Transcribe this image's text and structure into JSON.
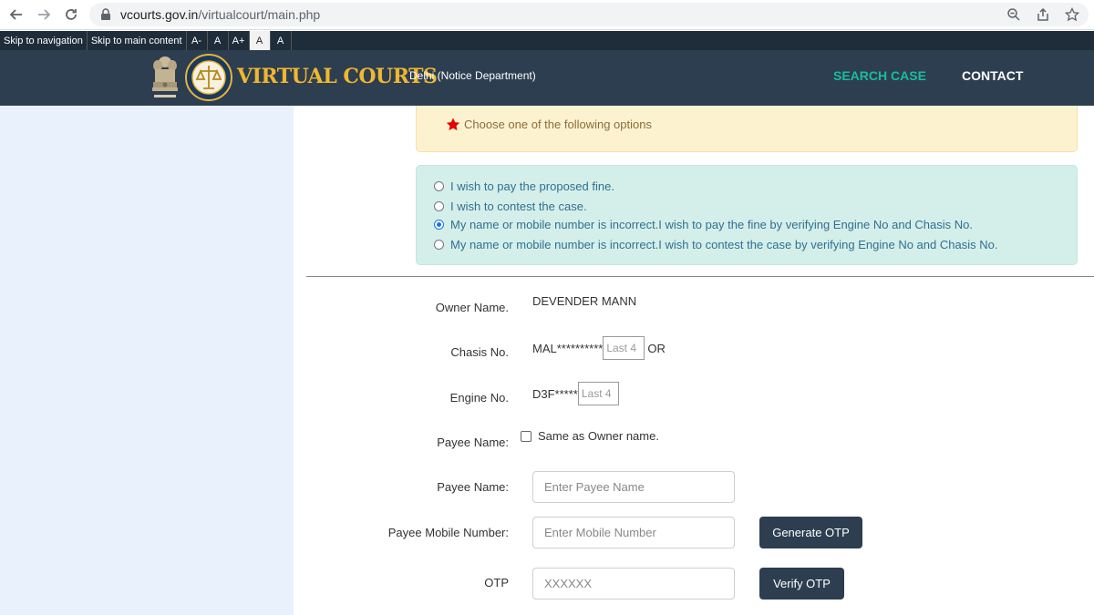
{
  "browser": {
    "url_host": "vcourts.gov.in",
    "url_path": "/virtualcourt/main.php"
  },
  "accessibility": {
    "skip_nav": "Skip to navigation",
    "skip_main": "Skip to main content",
    "font_decrease": "A-",
    "font_normal": "A",
    "font_increase": "A+",
    "theme_light": "A",
    "theme_dark": "A"
  },
  "header": {
    "brand": "VIRTUAL COURTS",
    "department": "Delhi (Notice Department)",
    "nav_search": "SEARCH CASE",
    "nav_contact": "CONTACT"
  },
  "notice": {
    "text": "Choose one of the following options"
  },
  "options": [
    {
      "label": "I wish to pay the proposed fine.",
      "selected": false
    },
    {
      "label": "I wish to contest the case.",
      "selected": false
    },
    {
      "label": "My name or mobile number is incorrect.I wish to pay the fine by verifying Engine No and Chasis No.",
      "selected": true
    },
    {
      "label": "My name or mobile number is incorrect.I wish to contest the case by verifying Engine No and Chasis No.",
      "selected": false
    }
  ],
  "form": {
    "owner_label": "Owner Name.",
    "owner_value": "DEVENDER MANN",
    "chasis_label": "Chasis No.",
    "chasis_prefix": "MAL**********",
    "chasis_placeholder": "Last 4",
    "chasis_suffix": "OR",
    "engine_label": "Engine No.",
    "engine_prefix": "D3F*****",
    "engine_placeholder": "Last 4",
    "payee_check_label": "Payee Name:",
    "same_as_owner": "Same as Owner name.",
    "payee_label": "Payee Name:",
    "payee_placeholder": "Enter Payee Name",
    "mobile_label": "Payee Mobile Number:",
    "mobile_placeholder": "Enter Mobile Number",
    "generate_otp": "Generate OTP",
    "otp_label": "OTP",
    "otp_placeholder": "XXXXXX",
    "verify_otp": "Verify OTP"
  },
  "colors": {
    "header_bg": "#2c3e50",
    "brand_gold": "#f0b630",
    "nav_active": "#1abc9c",
    "sidebar_bg": "#e9f1fd",
    "warning_bg": "#fdf2d0",
    "options_bg": "#d4efea"
  }
}
